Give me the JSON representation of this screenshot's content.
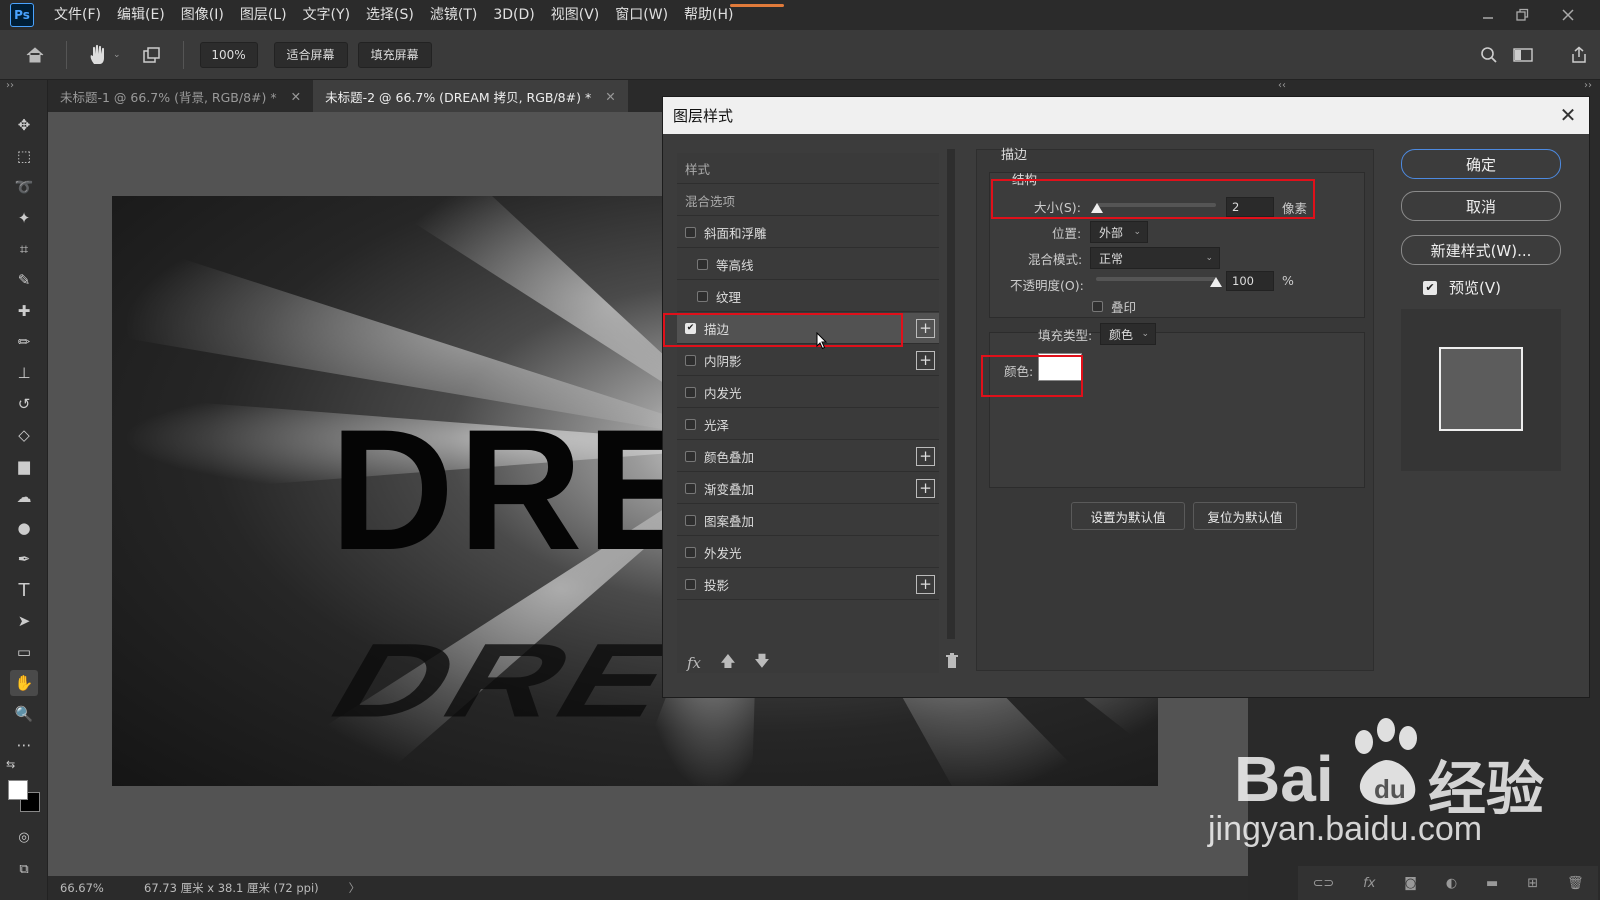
{
  "app": {
    "logo": "Ps"
  },
  "menubar": {
    "items": [
      "文件(F)",
      "编辑(E)",
      "图像(I)",
      "图层(L)",
      "文字(Y)",
      "选择(S)",
      "滤镜(T)",
      "3D(D)",
      "视图(V)",
      "窗口(W)",
      "帮助(H)"
    ]
  },
  "options": {
    "zoom": "100%",
    "fit_screen": "适合屏幕",
    "fill_screen": "填充屏幕"
  },
  "tabs": [
    {
      "label": "未标题-1 @ 66.7% (背景, RGB/8#) *"
    },
    {
      "label": "未标题-2 @ 66.7% (DREAM 拷贝, RGB/8#) *"
    }
  ],
  "canvas": {
    "text": "DRE"
  },
  "status": {
    "zoom": "66.67%",
    "size": "67.73 厘米 x 38.1 厘米 (72 ppi)"
  },
  "dialog": {
    "title": "图层样式",
    "styles_header": "样式",
    "blend_options": "混合选项",
    "style_items": [
      {
        "label": "斜面和浮雕",
        "checked": false,
        "indent": false,
        "plus": false
      },
      {
        "label": "等高线",
        "checked": false,
        "indent": true,
        "plus": false
      },
      {
        "label": "纹理",
        "checked": false,
        "indent": true,
        "plus": false
      },
      {
        "label": "描边",
        "checked": true,
        "indent": false,
        "plus": true
      },
      {
        "label": "内阴影",
        "checked": false,
        "indent": false,
        "plus": true
      },
      {
        "label": "内发光",
        "checked": false,
        "indent": false,
        "plus": false
      },
      {
        "label": "光泽",
        "checked": false,
        "indent": false,
        "plus": false
      },
      {
        "label": "颜色叠加",
        "checked": false,
        "indent": false,
        "plus": true
      },
      {
        "label": "渐变叠加",
        "checked": false,
        "indent": false,
        "plus": true
      },
      {
        "label": "图案叠加",
        "checked": false,
        "indent": false,
        "plus": false
      },
      {
        "label": "外发光",
        "checked": false,
        "indent": false,
        "plus": false
      },
      {
        "label": "投影",
        "checked": false,
        "indent": false,
        "plus": true
      }
    ],
    "footer": {
      "fx": "fx"
    },
    "stroke": {
      "section_title": "描边",
      "structure_title": "结构",
      "size_label": "大小(S):",
      "size_value": "2",
      "size_unit": "像素",
      "size_fraction": 0.01,
      "position_label": "位置:",
      "position_value": "外部",
      "blend_label": "混合模式:",
      "blend_value": "正常",
      "opacity_label": "不透明度(O):",
      "opacity_value": "100",
      "opacity_unit": "%",
      "opacity_fraction": 1.0,
      "overprint_label": "叠印",
      "fill_type_label": "填充类型:",
      "fill_type_value": "颜色",
      "color_label": "颜色:",
      "stroke_color": "#ffffff",
      "set_default": "设置为默认值",
      "reset_default": "复位为默认值"
    },
    "buttons": {
      "ok": "确定",
      "cancel": "取消",
      "new_style": "新建样式(W)...",
      "preview": "预览(V)"
    }
  },
  "watermark": {
    "brand": "Bai",
    "brand2": "经验",
    "url": "jingyan.baidu.com"
  },
  "colors": {
    "highlight": "#e0101a",
    "primary_button": "#4d8ae0",
    "ps_blue": "#4aa3ff"
  }
}
